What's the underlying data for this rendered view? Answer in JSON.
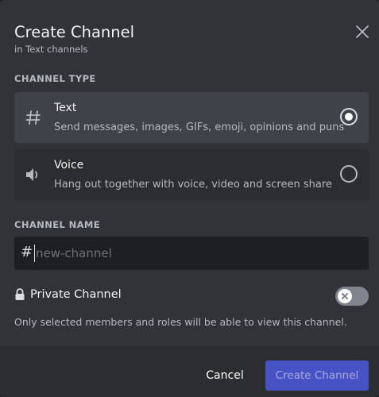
{
  "modal": {
    "title": "Create Channel",
    "subtitle": "in Text channels",
    "close_icon": "close-icon"
  },
  "channel_type": {
    "label": "CHANNEL TYPE",
    "selected": "text",
    "options": [
      {
        "id": "text",
        "icon": "hash-icon",
        "name": "Text",
        "description": "Send messages, images, GIFs, emoji, opinions and puns",
        "selected": true
      },
      {
        "id": "voice",
        "icon": "speaker-icon",
        "name": "Voice",
        "description": "Hang out together with voice, video and screen share",
        "selected": false
      }
    ]
  },
  "channel_name": {
    "label": "CHANNEL NAME",
    "prefix": "#",
    "value": "",
    "placeholder": "new-channel"
  },
  "private_channel": {
    "label": "Private Channel",
    "icon": "lock-icon",
    "enabled": false,
    "help": "Only selected members and roles will be able to view this channel."
  },
  "footer": {
    "cancel_label": "Cancel",
    "create_label": "Create Channel"
  },
  "colors": {
    "modal_bg": "#313338",
    "selected_option_bg": "#404249",
    "option_bg": "#2b2d31",
    "input_bg": "#1e1f22",
    "brand": "#4752c4"
  }
}
